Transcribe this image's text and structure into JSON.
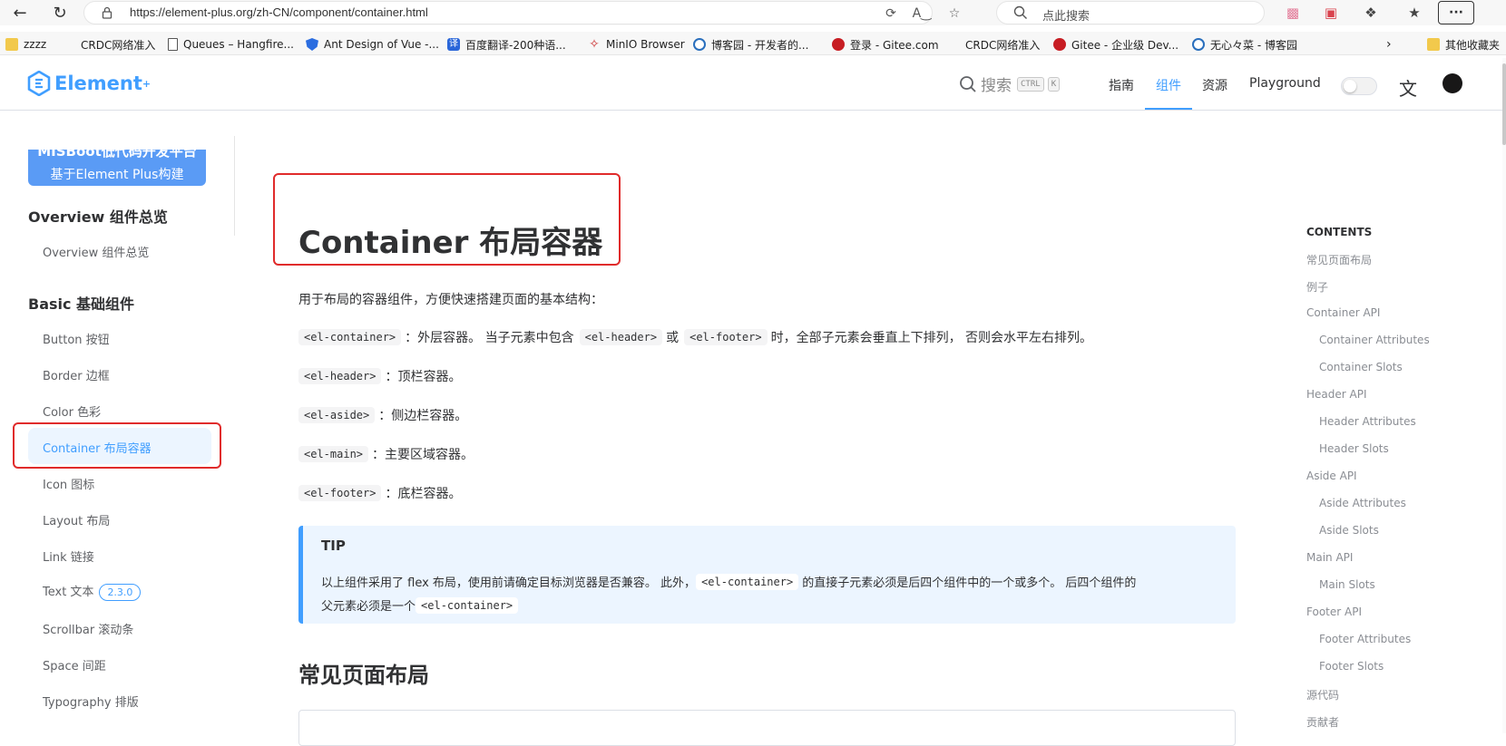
{
  "browser": {
    "url": "https://element-plus.org/zh-CN/component/container.html",
    "search_placeholder": "点此搜索",
    "more_label": "···",
    "bookmarks": [
      "zzzz",
      "CRDC网络准入",
      "Queues – Hangfire...",
      "Ant Design of Vue -...",
      "百度翻译-200种语...",
      "MinIO Browser",
      "博客园 - 开发者的...",
      "登录 - Gitee.com",
      "CRDC网络准入",
      "Gitee - 企业级 Dev...",
      "无心々菜 - 博客园",
      "其他收藏夹"
    ]
  },
  "header": {
    "logo_text": "Element",
    "logo_sup": "+",
    "search_label": "搜索",
    "kbd_ctrl": "CTRL",
    "kbd_k": "K",
    "nav": [
      "指南",
      "组件",
      "资源",
      "Playground"
    ],
    "active_nav": "组件",
    "accent_color": "#409eff"
  },
  "sidebar": {
    "ad_cut_text": "MISBoot低代码开发平台",
    "ad_text": "基于Element Plus构建",
    "overview_title": "Overview 组件总览",
    "overview_item": "Overview 组件总览",
    "basic_title": "Basic 基础组件",
    "items": [
      "Button 按钮",
      "Border 边框",
      "Color 色彩",
      "Container 布局容器",
      "Icon 图标",
      "Layout 布局",
      "Link 链接",
      "Text 文本",
      "Scrollbar 滚动条",
      "Space 间距",
      "Typography 排版"
    ],
    "text_badge": "2.3.0",
    "active_item": "Container 布局容器"
  },
  "main": {
    "title": "Container 布局容器",
    "intro": "用于布局的容器组件，方便快速搭建页面的基本结构：",
    "p1_code": "<el-container>",
    "p1_text_a": "：外层容器。 当子元素中包含",
    "p1_code2": "<el-header>",
    "p1_or": "或",
    "p1_code3": "<el-footer>",
    "p1_text_b": "时，全部子元素会垂直上下排列， 否则会水平左右排列。",
    "p2_code": "<el-header>",
    "p2_text": "：顶栏容器。",
    "p3_code": "<el-aside>",
    "p3_text": "：侧边栏容器。",
    "p4_code": "<el-main>",
    "p4_text": "：主要区域容器。",
    "p5_code": "<el-footer>",
    "p5_text": "：底栏容器。",
    "tip_title": "TIP",
    "tip_a": "以上组件采用了 flex 布局，使用前请确定目标浏览器是否兼容。 此外，",
    "tip_code": "<el-container>",
    "tip_b": "的直接子元素必须是后四个组件中的一个或多个。 后四个组件的",
    "tip_c": "父元素必须是一个",
    "tip_code2": "<el-container>",
    "section_title": "常见页面布局"
  },
  "toc": {
    "heading": "CONTENTS",
    "items": [
      "常见页面布局",
      "例子",
      "Container API",
      "Container Attributes",
      "Container Slots",
      "Header API",
      "Header Attributes",
      "Header Slots",
      "Aside API",
      "Aside Attributes",
      "Aside Slots",
      "Main API",
      "Main Slots",
      "Footer API",
      "Footer Attributes",
      "Footer Slots",
      "源代码",
      "贡献者"
    ]
  }
}
